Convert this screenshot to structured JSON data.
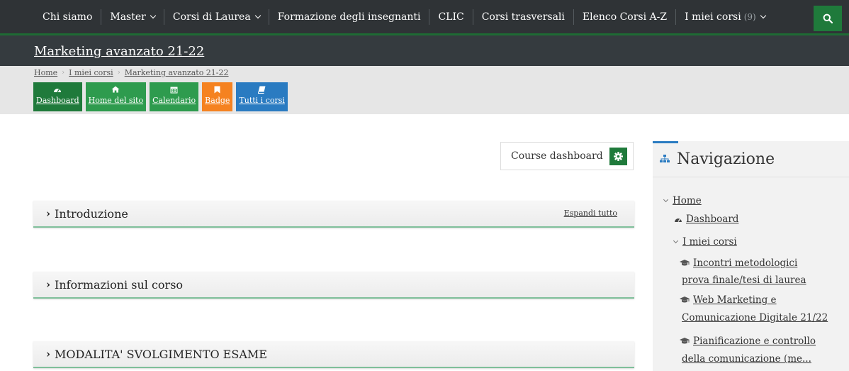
{
  "topnav": {
    "items": [
      {
        "label": "Chi siamo",
        "dropdown": false
      },
      {
        "label": "Master",
        "dropdown": true
      },
      {
        "label": "Corsi di Laurea",
        "dropdown": true
      },
      {
        "label": "Formazione degli insegnanti",
        "dropdown": false
      },
      {
        "label": "CLIC",
        "dropdown": false
      },
      {
        "label": "Corsi trasversali",
        "dropdown": false
      },
      {
        "label": "Elenco Corsi A-Z",
        "dropdown": false
      },
      {
        "label": "I miei corsi",
        "count": "(9)",
        "dropdown": true
      }
    ],
    "search_icon": "search-icon"
  },
  "course": {
    "title": "Marketing avanzato 21-22"
  },
  "breadcrumb": [
    "Home",
    "I miei corsi",
    "Marketing avanzato 21-22"
  ],
  "quick_buttons": [
    {
      "label": "Dashboard",
      "icon": "dashboard-icon",
      "color": "#1f7a3b"
    },
    {
      "label": "Home del sito",
      "icon": "home-icon",
      "color": "#2e9b4e"
    },
    {
      "label": "Calendario",
      "icon": "calendar-icon",
      "color": "#2e9b4e"
    },
    {
      "label": "Badge",
      "icon": "bookmark-icon",
      "color": "#f58220"
    },
    {
      "label": "Tutti i corsi",
      "icon": "book-icon",
      "color": "#2a7bc1"
    }
  ],
  "course_dashboard": {
    "label": "Course dashboard",
    "icon": "gear-icon"
  },
  "sections": [
    {
      "title": "Introduzione",
      "expand_all": "Espandi tutto"
    },
    {
      "title": "Informazioni sul corso"
    },
    {
      "title": "MODALITA' SVOLGIMENTO ESAME"
    }
  ],
  "navigation": {
    "title": "Navigazione",
    "home": "Home",
    "dashboard": "Dashboard",
    "my_courses": "I miei corsi",
    "courses": [
      {
        "line1": "Incontri metodologici",
        "line2": "prova finale/tesi di laurea"
      },
      {
        "line1": "Web Marketing e",
        "line2": "Comunicazione Digitale 21/22"
      },
      {
        "line1": "Pianificazione e controllo",
        "line2": "della comunicazione (me..."
      }
    ]
  },
  "colors": {
    "brand_green": "#1f7a3b",
    "accent_blue": "#2a7bc1",
    "badge_orange": "#f58220",
    "topbar": "#2f3336"
  }
}
